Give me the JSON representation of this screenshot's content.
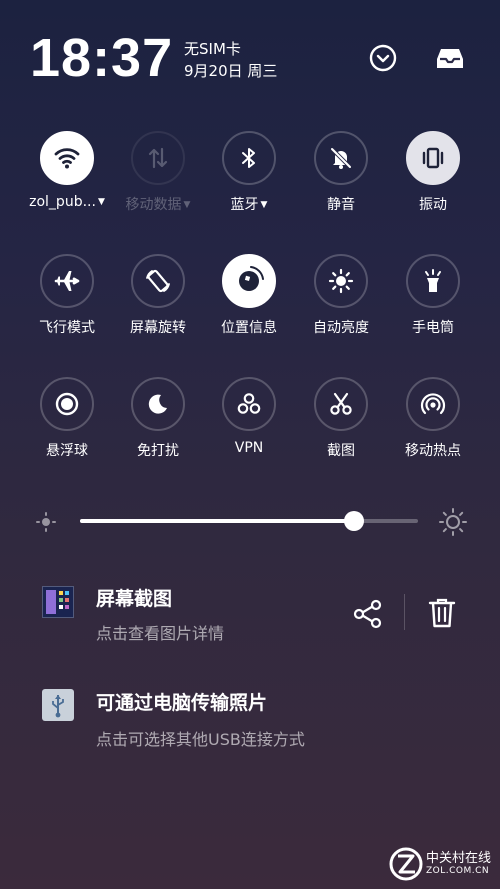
{
  "status": {
    "time": "18:37",
    "sim": "无SIM卡",
    "date": "9月20日 周三"
  },
  "header": {
    "expand_icon": "chevron-circle-icon",
    "tray_icon": "inbox-tray-icon"
  },
  "tiles": [
    {
      "label": "zol_pub...",
      "icon": "wifi-icon",
      "state": "on",
      "caret": true
    },
    {
      "label": "移动数据",
      "icon": "mobile-data-icon",
      "state": "disabled",
      "caret": true
    },
    {
      "label": "蓝牙",
      "icon": "bluetooth-icon",
      "state": "off",
      "caret": true
    },
    {
      "label": "静音",
      "icon": "bell-muted-icon",
      "state": "off"
    },
    {
      "label": "振动",
      "icon": "vibrate-icon",
      "state": "on"
    },
    {
      "label": "飞行模式",
      "icon": "airplane-icon",
      "state": "off"
    },
    {
      "label": "屏幕旋转",
      "icon": "rotate-icon",
      "state": "off"
    },
    {
      "label": "位置信息",
      "icon": "location-icon",
      "state": "on"
    },
    {
      "label": "自动亮度",
      "icon": "auto-brightness-icon",
      "state": "off"
    },
    {
      "label": "手电筒",
      "icon": "flashlight-icon",
      "state": "off"
    },
    {
      "label": "悬浮球",
      "icon": "floating-ball-icon",
      "state": "off"
    },
    {
      "label": "免打扰",
      "icon": "moon-icon",
      "state": "off"
    },
    {
      "label": "VPN",
      "icon": "vpn-icon",
      "state": "off"
    },
    {
      "label": "截图",
      "icon": "scissors-icon",
      "state": "off"
    },
    {
      "label": "移动热点",
      "icon": "hotspot-icon",
      "state": "off"
    }
  ],
  "brightness": {
    "level": 0.81,
    "low_icon": "brightness-low-icon",
    "high_icon": "brightness-high-icon"
  },
  "notifications": [
    {
      "title": "屏幕截图",
      "subtitle": "点击查看图片详情",
      "icon": "screenshot-thumbnail",
      "actions": [
        "share-icon",
        "trash-icon"
      ]
    },
    {
      "title": "可通过电脑传输照片",
      "subtitle": "点击可选择其他USB连接方式",
      "icon": "usb-icon"
    }
  ],
  "watermark": {
    "cn": "中关村在线",
    "en": "ZOL.COM.CN"
  },
  "colors": {
    "tile_on": "#ffffff",
    "vibrate_on": "#e3e3ea",
    "icon_dark": "#1e2238"
  }
}
